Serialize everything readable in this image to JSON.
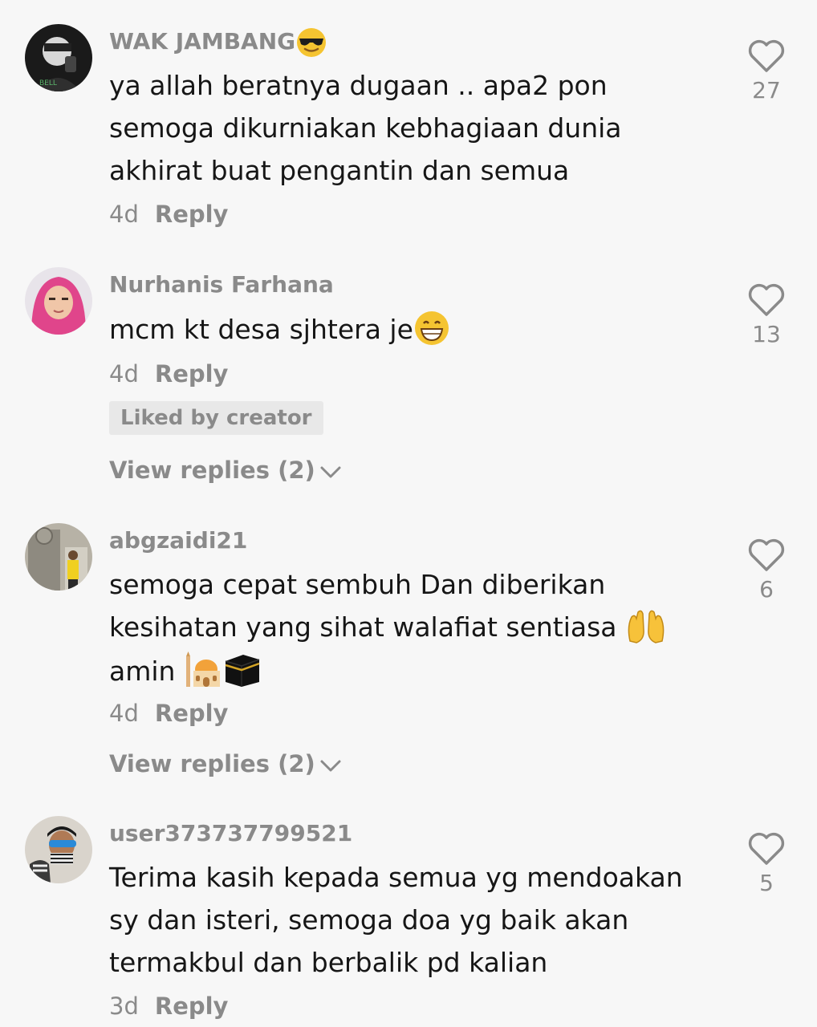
{
  "comments": [
    {
      "username": "WAK JAMBANG",
      "username_emoji": "sunglasses-emoji",
      "text": "ya allah beratnya dugaan .. apa2 pon semoga dikurniakan kebhagiaan dunia akhirat buat pengantin dan semua",
      "time": "4d",
      "reply_label": "Reply",
      "likes": "27"
    },
    {
      "username": "Nurhanis Farhana",
      "text": "mcm kt desa sjhtera je",
      "text_emoji": "grinning-emoji",
      "time": "4d",
      "reply_label": "Reply",
      "likes": "13",
      "liked_by_creator": "Liked by creator",
      "view_replies": "View replies (2)"
    },
    {
      "username": "abgzaidi21",
      "text_line1": "semoga cepat sembuh Dan diberikan",
      "text_line2": "kesihatan yang sihat walafiat sentiasa",
      "text_line3": "amin",
      "text_emojis": [
        "raising-hands-emoji",
        "mosque-emoji",
        "kaaba-emoji"
      ],
      "time": "4d",
      "reply_label": "Reply",
      "likes": "6",
      "view_replies": "View replies (2)"
    },
    {
      "username": "user373737799521",
      "text": "Terima kasih kepada semua yg mendoakan sy dan isteri, semoga doa yg baik akan termakbul dan berbalik pd kalian",
      "time": "3d",
      "reply_label": "Reply",
      "likes": "5"
    }
  ],
  "icons": {
    "like": "heart-outline-icon",
    "expand": "chevron-down-icon"
  },
  "colors": {
    "background": "#f7f7f7",
    "text": "#161616",
    "secondary": "#8a8a8a"
  }
}
